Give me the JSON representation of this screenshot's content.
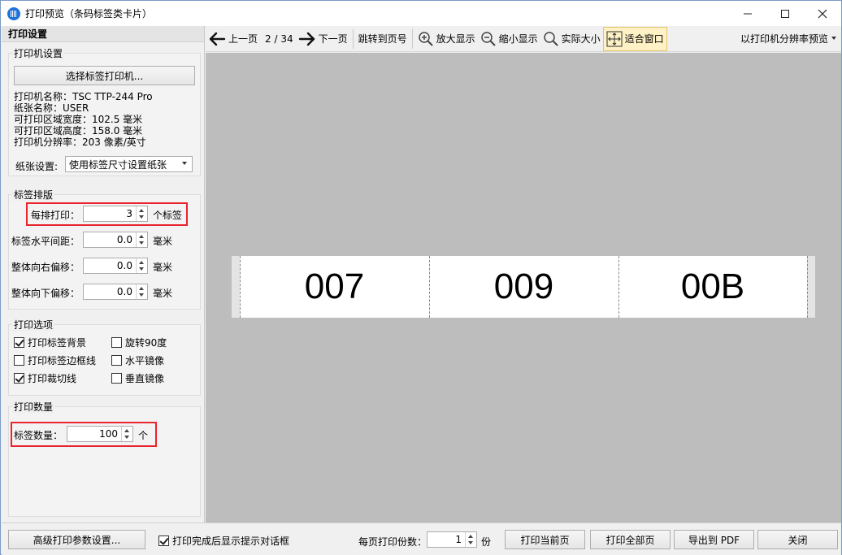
{
  "window": {
    "title": "打印预览（条码标签类卡片）"
  },
  "left_panel": {
    "header": "打印设置",
    "printer_group": {
      "title": "打印机设置",
      "select_button": "选择标签打印机...",
      "printer_name": "打印机名称：TSC TTP-244 Pro",
      "paper_name": "纸张名称：USER",
      "print_width": "可打印区域宽度：102.5 毫米",
      "print_height": "可打印区域高度：158.0 毫米",
      "resolution": "打印机分辨率：203 像素/英寸",
      "paper_label": "纸张设置:",
      "paper_value": "使用标签尺寸设置纸张"
    },
    "layout_group": {
      "title": "标签排版",
      "per_row_label": "每排打印：",
      "per_row_value": "3",
      "per_row_unit": "个标签",
      "h_gap_label": "标签水平间距：",
      "h_gap_value": "0.0",
      "h_gap_unit": "毫米",
      "right_offset_label": "整体向右偏移：",
      "right_offset_value": "0.0",
      "right_offset_unit": "毫米",
      "down_offset_label": "整体向下偏移：",
      "down_offset_value": "0.0",
      "down_offset_unit": "毫米"
    },
    "options_group": {
      "title": "打印选项",
      "print_bg": {
        "label": "打印标签背景",
        "checked": true
      },
      "rotate90": {
        "label": "旋转90度",
        "checked": false
      },
      "print_border": {
        "label": "打印标签边框线",
        "checked": false
      },
      "h_mirror": {
        "label": "水平镜像",
        "checked": false
      },
      "print_cut": {
        "label": "打印裁切线",
        "checked": true
      },
      "v_mirror": {
        "label": "垂直镜像",
        "checked": false
      }
    },
    "qty_group": {
      "title": "打印数量",
      "qty_label": "标签数量：",
      "qty_value": "100",
      "qty_unit": "个"
    }
  },
  "toolbar": {
    "prev": "上一页",
    "page": "2 / 34",
    "next": "下一页",
    "jump": "跳转到页号",
    "zoom_in": "放大显示",
    "zoom_out": "缩小显示",
    "actual": "实际大小",
    "fit": "适合窗口",
    "mode": "以打印机分辨率预览"
  },
  "preview": {
    "labels": [
      "007",
      "009",
      "00B"
    ]
  },
  "bottom": {
    "advanced": "高级打印参数设置...",
    "show_dialog": {
      "label": "打印完成后显示提示对话框",
      "checked": true
    },
    "copies_label": "每页打印份数：",
    "copies_value": "1",
    "copies_unit": "份",
    "print_current": "打印当前页",
    "print_all": "打印全部页",
    "export_pdf": "导出到 PDF",
    "close": "关闭"
  }
}
